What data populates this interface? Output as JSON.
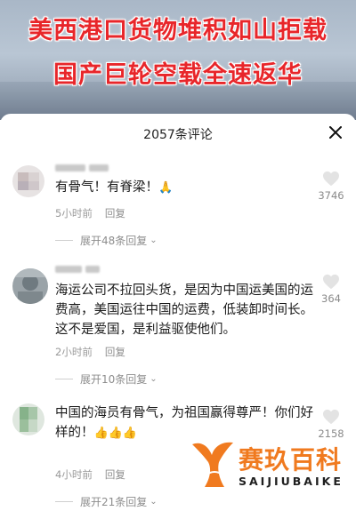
{
  "video": {
    "headline_line1": "美西港口货物堆积如山拒载",
    "headline_line2": "国产巨轮空载全速返华"
  },
  "sheet": {
    "title": "2057条评论",
    "close_icon": "close-icon"
  },
  "comments": [
    {
      "text": "有骨气！有脊梁！",
      "emoji": "🙏",
      "time": "5小时前",
      "reply_label": "回复",
      "expand_label": "展开48条回复",
      "likes": "3746"
    },
    {
      "text": "海运公司不拉回头货，是因为中国运美国的运费高，美国运往中国的运费，低装卸时间长。这不是爱国，是利益驱使他们。",
      "time": "2小时前",
      "reply_label": "回复",
      "expand_label": "展开10条回复",
      "likes": "364"
    },
    {
      "text": "中国的海员有骨气，为祖国赢得尊严！你们好样的！",
      "emoji": "👍👍👍",
      "time": "4小时前",
      "reply_label": "回复",
      "expand_label": "展开21条回复",
      "likes": "2158"
    }
  ],
  "watermark": {
    "name_cn": "赛玖百科",
    "name_en": "SAIJIUBAIKE"
  },
  "colors": {
    "headline": "#e8262a",
    "watermark_orange": "#f07a1f",
    "muted_text": "#9a9a9a"
  }
}
